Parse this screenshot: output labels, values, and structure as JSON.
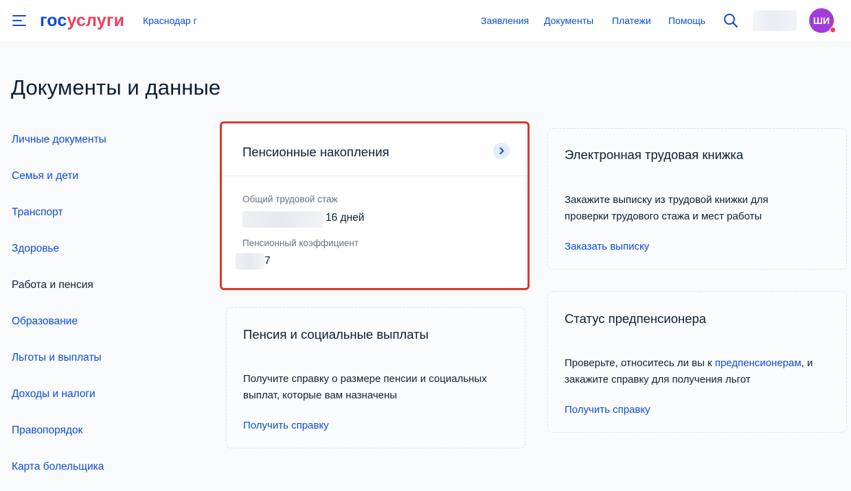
{
  "header": {
    "logo_part1": "гос",
    "logo_part2": "услуги",
    "city": "Краснодар г",
    "nav": [
      "Заявления",
      "Документы",
      "Платежи",
      "Помощь"
    ],
    "avatar_initials": "ШИ"
  },
  "page_title": "Документы и данные",
  "sidebar": {
    "items": [
      {
        "label": "Личные документы"
      },
      {
        "label": "Семья и дети"
      },
      {
        "label": "Транспорт"
      },
      {
        "label": "Здоровье"
      },
      {
        "label": "Работа и пенсия"
      },
      {
        "label": "Образование"
      },
      {
        "label": "Льготы и выплаты"
      },
      {
        "label": "Доходы и налоги"
      },
      {
        "label": "Правопорядок"
      },
      {
        "label": "Карта болельщика"
      }
    ],
    "active_index": 4
  },
  "pension_savings": {
    "title": "Пенсионные накопления",
    "experience_label": "Общий трудовой стаж",
    "experience_value": "16 дней",
    "coefficient_label": "Пенсионный коэффициент",
    "coefficient_value": "7"
  },
  "pension_payments": {
    "title": "Пенсия и социальные выплаты",
    "text": "Получите справку о размере пенсии и социальных выплат, которые вам назначены",
    "link": "Получить справку"
  },
  "work_book": {
    "title": "Электронная трудовая книжка",
    "text": "Закажите выписку из трудовой книжки для проверки трудового стажа и мест работы",
    "link": "Заказать выписку"
  },
  "pre_pensioner": {
    "title": "Статус предпенсионера",
    "text_before": "Проверьте, относитесь ли вы к ",
    "text_link": "предпенсионерам",
    "text_after": ", и закажите справку для получения льгот",
    "link": "Получить справку"
  },
  "colors": {
    "brand_blue": "#0d4cd3",
    "brand_red": "#ee3f58",
    "highlight": "#e0352b",
    "avatar": "#a33bd6"
  }
}
